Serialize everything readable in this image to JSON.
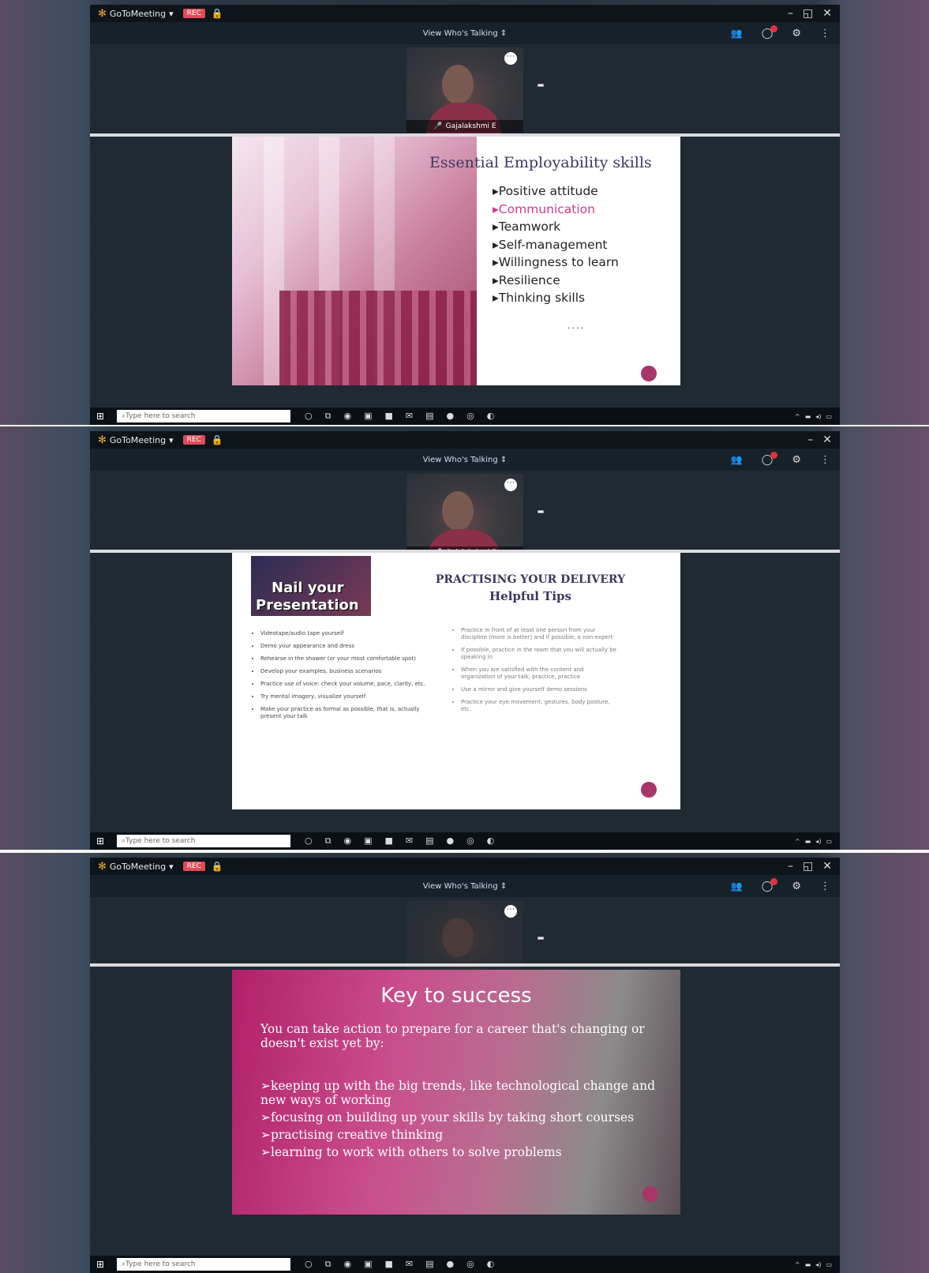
{
  "app": {
    "brand": "GoToMeeting",
    "record_label": "REC",
    "view_selector": "View Who's Talking",
    "presenter_name": "Gajalakshmi E",
    "search_placeholder": "Type here to search"
  },
  "slides": [
    {
      "title": "Essential Employability skills",
      "items": [
        "Positive attitude",
        "Communication",
        "Teamwork",
        "Self-management",
        "Willingness to learn",
        "Resilience",
        "Thinking skills"
      ],
      "ellipsis": "....",
      "highlight_color": "#d23a88"
    },
    {
      "thumbnail_line1": "Nail your",
      "thumbnail_line2": "Presentation",
      "heading1": "PRACTISING YOUR DELIVERY",
      "heading2": "Helpful Tips",
      "left_tips": [
        "Videotape/audio tape yourself",
        "Demo your appearance and dress",
        "Rehearse in the shower (or your most comfortable spot)",
        "Develop your examples, business scenarios",
        "Practice use of voice: check your volume, pace, clarity, etc.",
        "Try mental imagery, visualize yourself",
        "Make your practice as formal as possible, that is, actually present your talk"
      ],
      "right_tips": [
        "Practice in front of at least one person from your discipline (more is better) and if possible, a non-expert",
        "If possible, practice in the room that you will actually be speaking in",
        "When you are satisfied with the content and organization of your talk, practice, practice",
        "Use a mirror and give yourself demo sessions",
        "Practice your eye movement, gestures, body posture, etc."
      ]
    },
    {
      "title": "Key to success",
      "intro": "You can take action to prepare for a career that's changing or doesn't exist yet by:",
      "items": [
        "➢keeping up with the big trends, like technological change and new ways of working",
        "➢focusing on building up your skills by taking short courses",
        "➢practising creative thinking",
        "➢learning to work with others to solve problems"
      ]
    }
  ],
  "colors": {
    "accent_red": "#e2323f",
    "brand_orange": "#f2a93b",
    "slide_title": "#3c3860"
  }
}
